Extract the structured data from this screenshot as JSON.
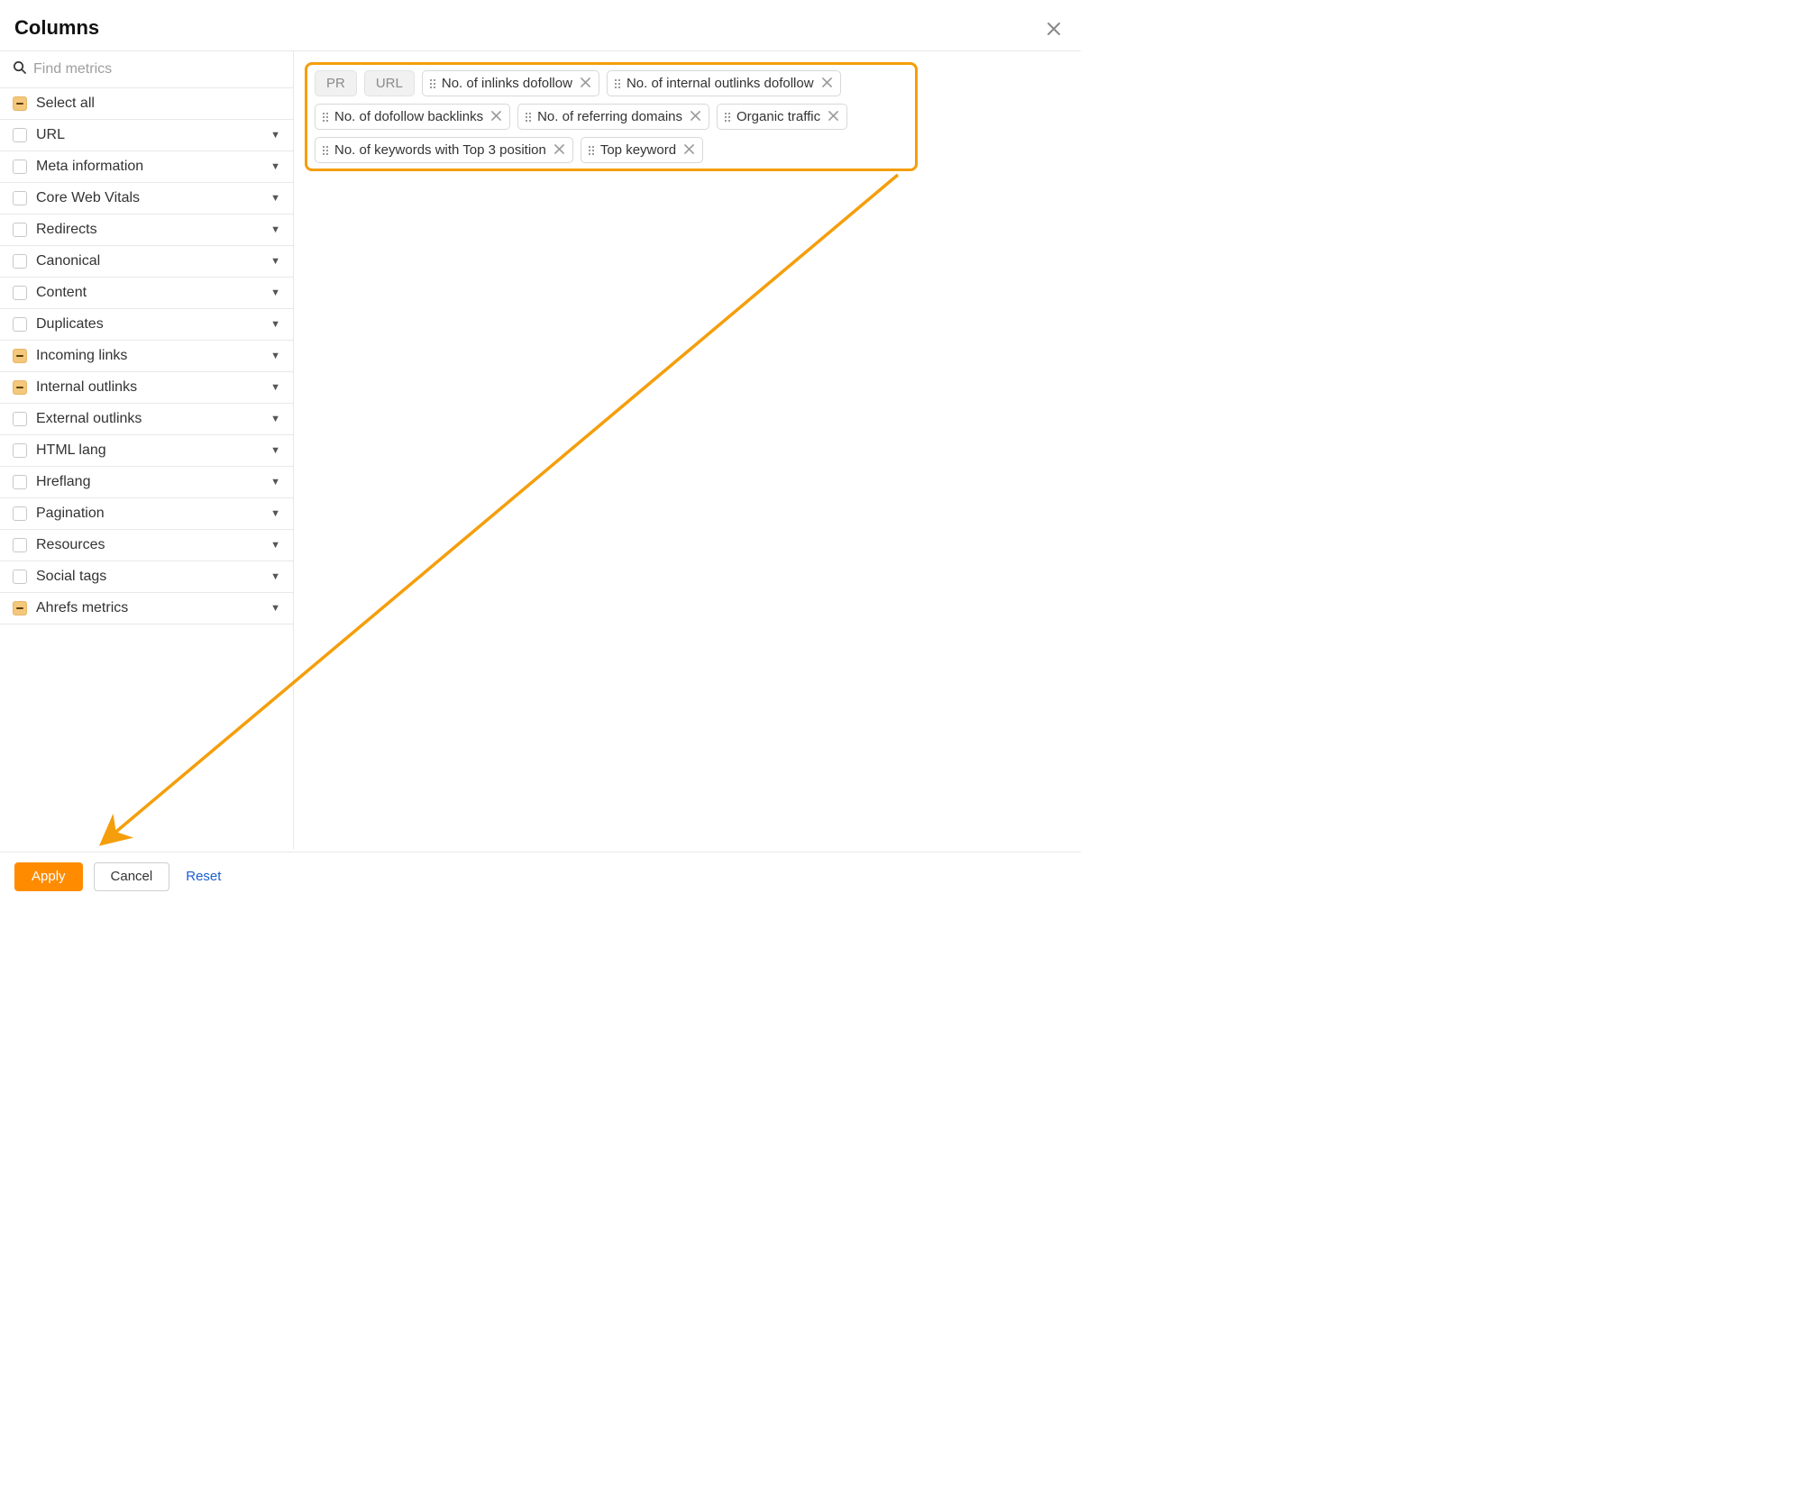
{
  "header": {
    "title": "Columns"
  },
  "search": {
    "placeholder": "Find metrics"
  },
  "sidebar": {
    "items": [
      {
        "label": "Select all",
        "state": "partial",
        "expandable": false
      },
      {
        "label": "URL",
        "state": "unchecked",
        "expandable": true
      },
      {
        "label": "Meta information",
        "state": "unchecked",
        "expandable": true
      },
      {
        "label": "Core Web Vitals",
        "state": "unchecked",
        "expandable": true
      },
      {
        "label": "Redirects",
        "state": "unchecked",
        "expandable": true
      },
      {
        "label": "Canonical",
        "state": "unchecked",
        "expandable": true
      },
      {
        "label": "Content",
        "state": "unchecked",
        "expandable": true
      },
      {
        "label": "Duplicates",
        "state": "unchecked",
        "expandable": true
      },
      {
        "label": "Incoming links",
        "state": "partial",
        "expandable": true
      },
      {
        "label": "Internal outlinks",
        "state": "partial",
        "expandable": true
      },
      {
        "label": "External outlinks",
        "state": "unchecked",
        "expandable": true
      },
      {
        "label": "HTML lang",
        "state": "unchecked",
        "expandable": true
      },
      {
        "label": "Hreflang",
        "state": "unchecked",
        "expandable": true
      },
      {
        "label": "Pagination",
        "state": "unchecked",
        "expandable": true
      },
      {
        "label": "Resources",
        "state": "unchecked",
        "expandable": true
      },
      {
        "label": "Social tags",
        "state": "unchecked",
        "expandable": true
      },
      {
        "label": "Ahrefs metrics",
        "state": "partial",
        "expandable": true
      }
    ]
  },
  "chips": {
    "locked": [
      {
        "label": "PR"
      },
      {
        "label": "URL"
      }
    ],
    "items": [
      {
        "label": "No. of inlinks dofollow"
      },
      {
        "label": "No. of internal outlinks dofollow"
      },
      {
        "label": "No. of dofollow backlinks"
      },
      {
        "label": "No. of referring domains"
      },
      {
        "label": "Organic traffic"
      },
      {
        "label": "No. of keywords with Top 3 position"
      },
      {
        "label": "Top keyword"
      }
    ]
  },
  "footer": {
    "apply": "Apply",
    "cancel": "Cancel",
    "reset": "Reset"
  },
  "annotation": {
    "arrow_color": "#f59e0b"
  }
}
